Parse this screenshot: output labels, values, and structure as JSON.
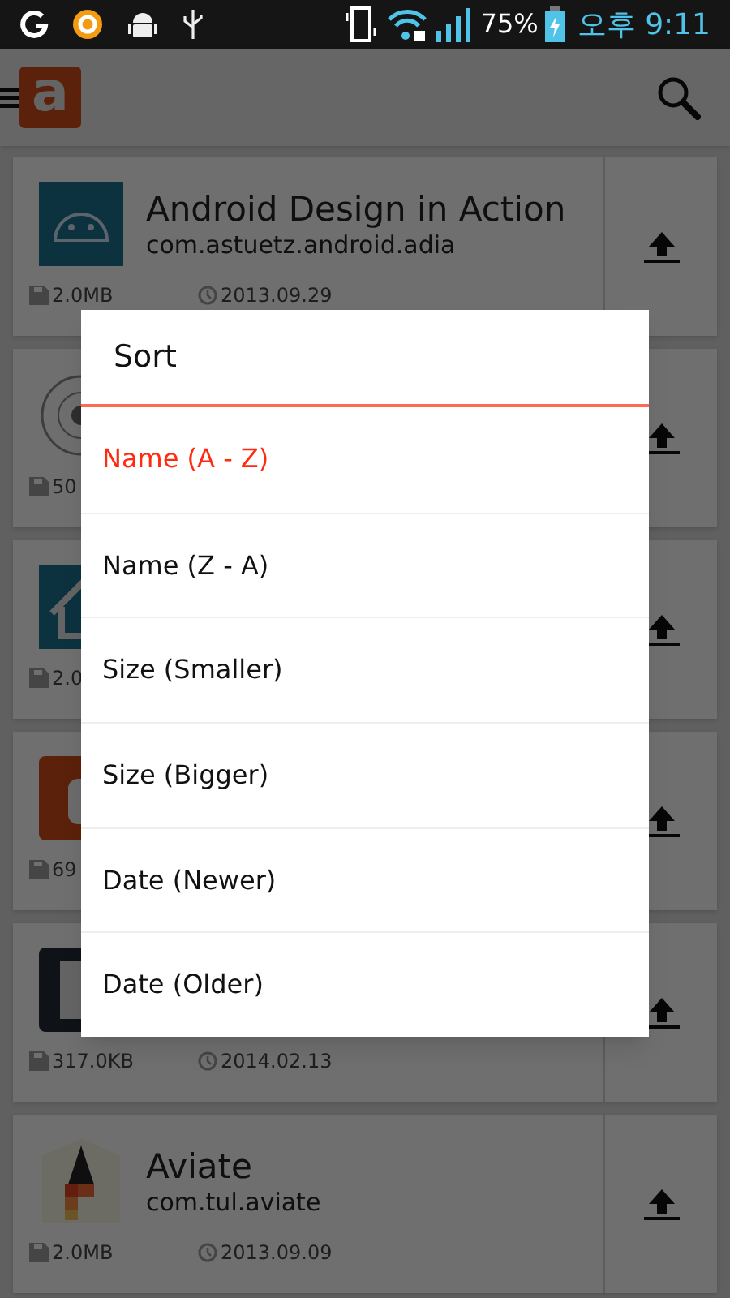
{
  "status_bar": {
    "battery": "75%",
    "time": "오후 9:11"
  },
  "app_bar": {
    "logo": "a"
  },
  "apps": [
    {
      "name": "Android Design in Action",
      "package": "com.astuetz.android.adia",
      "size": "2.0MB",
      "date": "2013.09.29"
    },
    {
      "size": "50"
    },
    {
      "size": "2.0"
    },
    {
      "size": "69"
    },
    {
      "size": "317.0KB",
      "date": "2014.02.13"
    },
    {
      "name": "Aviate",
      "package": "com.tul.aviate",
      "size": "2.0MB",
      "date": "2013.09.09"
    }
  ],
  "sort_dialog": {
    "title": "Sort",
    "options": [
      {
        "label": "Name (A - Z)",
        "selected": true
      },
      {
        "label": "Name (Z - A)",
        "selected": false
      },
      {
        "label": "Size (Smaller)",
        "selected": false
      },
      {
        "label": "Size (Bigger)",
        "selected": false
      },
      {
        "label": "Date (Newer)",
        "selected": false
      },
      {
        "label": "Date (Older)",
        "selected": false
      }
    ]
  }
}
